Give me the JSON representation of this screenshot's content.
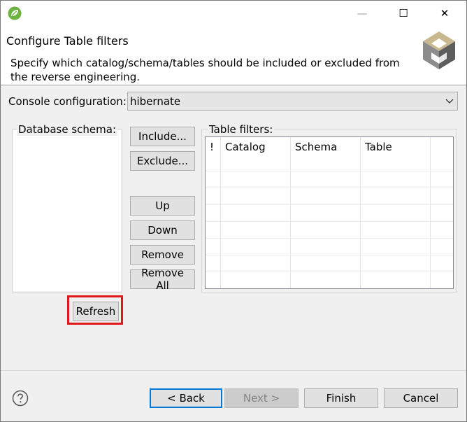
{
  "window": {
    "controls": {
      "minimize": "—",
      "maximize": "☐",
      "close": "✕"
    }
  },
  "header": {
    "title": "Configure Table filters",
    "description": "Specify which catalog/schema/tables should be included or excluded from the reverse engineering."
  },
  "console_configuration": {
    "label": "Console configuration:",
    "value": "hibernate"
  },
  "database_schema": {
    "label": "Database schema:",
    "refresh_label": "Refresh"
  },
  "middle_buttons": {
    "include": "Include...",
    "exclude": "Exclude...",
    "up": "Up",
    "down": "Down",
    "remove": "Remove",
    "remove_all": "Remove All"
  },
  "table_filters": {
    "label": "Table filters:",
    "columns": [
      "!",
      "Catalog",
      "Schema",
      "Table"
    ]
  },
  "footer": {
    "back": "< Back",
    "next": "Next >",
    "finish": "Finish",
    "cancel": "Cancel"
  },
  "colors": {
    "highlight": "#e0181b",
    "default_button_border": "#0078d7",
    "spring_green": "#6db33f"
  }
}
